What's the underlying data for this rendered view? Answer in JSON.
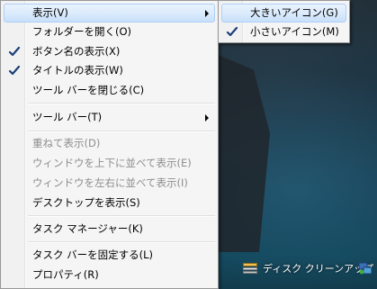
{
  "context_menu": {
    "items": [
      {
        "label": "表示(V)",
        "checked": false,
        "disabled": false,
        "submenu": true,
        "highlighted": true
      },
      {
        "label": "フォルダーを開く(O)",
        "checked": false,
        "disabled": false
      },
      {
        "label": "ボタン名の表示(X)",
        "checked": true,
        "disabled": false
      },
      {
        "label": "タイトルの表示(W)",
        "checked": true,
        "disabled": false
      },
      {
        "label": "ツール バーを閉じる(C)",
        "checked": false,
        "disabled": false
      },
      {
        "label": "ツール バー(T)",
        "checked": false,
        "disabled": false,
        "submenu": true
      },
      {
        "label": "重ねて表示(D)",
        "checked": false,
        "disabled": true
      },
      {
        "label": "ウィンドウを上下に並べて表示(E)",
        "checked": false,
        "disabled": true
      },
      {
        "label": "ウィンドウを左右に並べて表示(I)",
        "checked": false,
        "disabled": true
      },
      {
        "label": "デスクトップを表示(S)",
        "checked": false,
        "disabled": false
      },
      {
        "label": "タスク マネージャー(K)",
        "checked": false,
        "disabled": false
      },
      {
        "label": "タスク バーを固定する(L)",
        "checked": false,
        "disabled": false
      },
      {
        "label": "プロパティ(R)",
        "checked": false,
        "disabled": false
      }
    ]
  },
  "view_submenu": {
    "items": [
      {
        "label": "大きいアイコン(G)",
        "checked": false,
        "highlighted": true
      },
      {
        "label": "小さいアイコン(M)",
        "checked": true,
        "highlighted": false
      }
    ]
  },
  "taskbar": {
    "toolbar_label": "ディスク クリーンアップ",
    "toolbar_icon": "disk-cleanup-icon",
    "tray_icon": "network-icon"
  },
  "colors": {
    "highlight_border": "#aecff7",
    "highlight_fill": "#dcebfc",
    "check_color": "#1c3f78",
    "disabled_text": "#8d8d8d"
  }
}
